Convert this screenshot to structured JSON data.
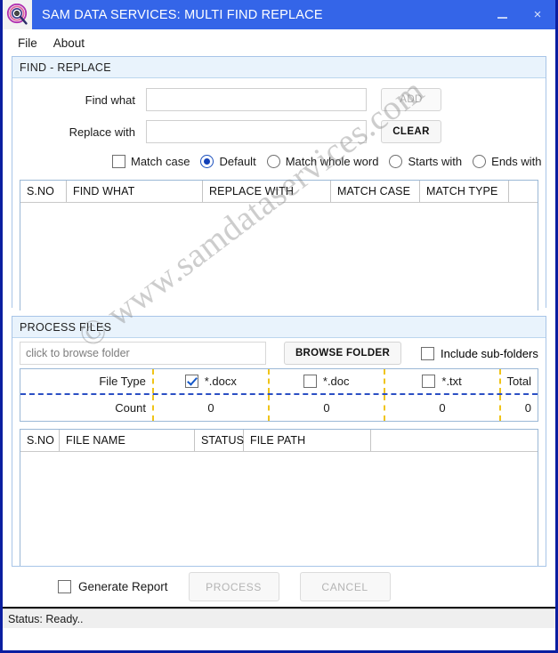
{
  "window": {
    "title": "SAM DATA SERVICES: MULTI FIND REPLACE",
    "icon": "magnifier-icon",
    "minimize_label": "–",
    "close_label": "×",
    "accent_color": "#3465e8",
    "border_color": "#0b1ea0"
  },
  "menu": {
    "items": [
      {
        "label": "File"
      },
      {
        "label": "About"
      }
    ]
  },
  "find_replace": {
    "group_title": "FIND - REPLACE",
    "find_what": {
      "label": "Find what",
      "value": "",
      "placeholder": ""
    },
    "replace_with": {
      "label": "Replace with",
      "value": "",
      "placeholder": ""
    },
    "add_button": {
      "label": "ADD",
      "enabled": false
    },
    "clear_button": {
      "label": "CLEAR",
      "enabled": true
    },
    "options": {
      "match_case": {
        "label": "Match case",
        "type": "checkbox",
        "checked": false
      },
      "modes": [
        {
          "label": "Default",
          "checked": true
        },
        {
          "label": "Match whole word",
          "checked": false
        },
        {
          "label": "Starts with",
          "checked": false
        },
        {
          "label": "Ends with",
          "checked": false
        }
      ]
    },
    "grid": {
      "columns": [
        "S.NO",
        "FIND WHAT",
        "REPLACE WITH",
        "MATCH CASE",
        "MATCH TYPE",
        ""
      ],
      "rows": []
    }
  },
  "process_files": {
    "group_title": "PROCESS FILES",
    "folder_input": {
      "value": "",
      "placeholder": "click to browse folder"
    },
    "browse_button": {
      "label": "BROWSE FOLDER"
    },
    "include_subfolders": {
      "label": "Include sub-folders",
      "checked": false
    },
    "file_type_table": {
      "row_labels": [
        "File Type",
        "Count"
      ],
      "types": [
        {
          "label": "*.docx",
          "checked": true,
          "count": "0"
        },
        {
          "label": "*.doc",
          "checked": false,
          "count": "0"
        },
        {
          "label": "*.txt",
          "checked": false,
          "count": "0"
        }
      ],
      "total_label": "Total",
      "total_count": "0"
    },
    "grid": {
      "columns": [
        "S.NO",
        "FILE NAME",
        "STATUS",
        "FILE PATH",
        ""
      ],
      "rows": []
    }
  },
  "actions": {
    "generate_report": {
      "label": "Generate Report",
      "checked": false
    },
    "process_button": {
      "label": "PROCESS",
      "enabled": false
    },
    "cancel_button": {
      "label": "CANCEL",
      "enabled": false
    }
  },
  "status_bar": {
    "text": "Status: Ready.."
  },
  "watermark": {
    "text": "© www.samdataservices.com"
  }
}
